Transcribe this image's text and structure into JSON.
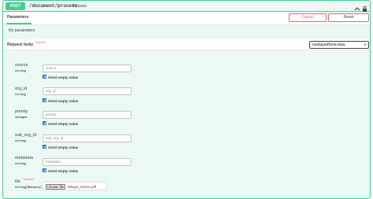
{
  "summary": {
    "method": "POST",
    "path": "/document/process",
    "description": "Process"
  },
  "tabs": {
    "parameters": "Parameters"
  },
  "buttons": {
    "cancel": "Cancel",
    "reset": "Reset"
  },
  "no_parameters": "No parameters",
  "request_body": {
    "title": "Request body",
    "required": "required",
    "content_type": "multipart/form-data"
  },
  "fields": [
    {
      "name": "source",
      "type": "string",
      "placeholder": "source",
      "send_empty": "Send empty value"
    },
    {
      "name": "org_id",
      "type": "string",
      "placeholder": "org_id",
      "send_empty": "Send empty value"
    },
    {
      "name": "priority",
      "type": "integer",
      "placeholder": "priority",
      "send_empty": "Send empty value"
    },
    {
      "name": "sub_org_id",
      "type": "string",
      "placeholder": "sub_org_id",
      "send_empty": "Send empty value"
    },
    {
      "name": "metadata",
      "type": "string",
      "placeholder": "metadata",
      "send_empty": "Send empty value"
    }
  ],
  "file_field": {
    "name": "file",
    "required": "* required",
    "type": "string($binary)",
    "choose_label": "Choose file",
    "file_name": "Mango_invoice.pdf"
  },
  "colors": {
    "post_accent": "#49cc90",
    "panel_bg": "#ebf8f3",
    "cancel": "#ff6060",
    "checkbox": "#1a73e8"
  },
  "icons": {
    "collapse": "chevron-up-icon",
    "lock": "lock-icon"
  }
}
